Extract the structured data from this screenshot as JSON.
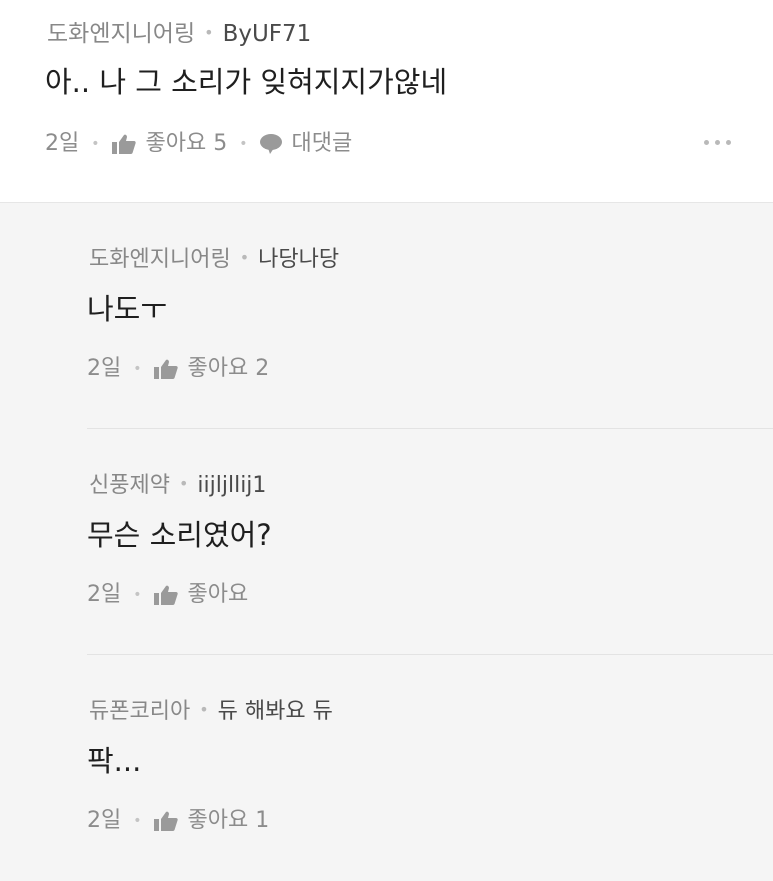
{
  "comment": {
    "company": "도화엔지니어링",
    "author": "ByUF71",
    "text": "아.. 나 그 소리가 잊혀지지가않네",
    "time": "2일",
    "like_label": "좋아요 5",
    "reply_label": "대댓글",
    "more_icon": "more-horizontal-icon"
  },
  "replies": [
    {
      "company": "도화엔지니어링",
      "author": "나당나당",
      "text": "나도ㅜ",
      "time": "2일",
      "like_label": "좋아요 2"
    },
    {
      "company": "신풍제약",
      "author": "iijljllij1",
      "text": "무슨 소리였어?",
      "time": "2일",
      "like_label": "좋아요"
    },
    {
      "company": "듀폰코리아",
      "author": "듀 해봐요 듀",
      "text": "팍...",
      "time": "2일",
      "like_label": "좋아요 1"
    }
  ],
  "icons": {
    "like": "thumbs-up-icon",
    "reply": "speech-bubble-icon"
  },
  "colors": {
    "background": "#f5f5f5",
    "card": "#ffffff",
    "muted_text": "#8c8c8c",
    "body_text": "#1f1f1f"
  }
}
